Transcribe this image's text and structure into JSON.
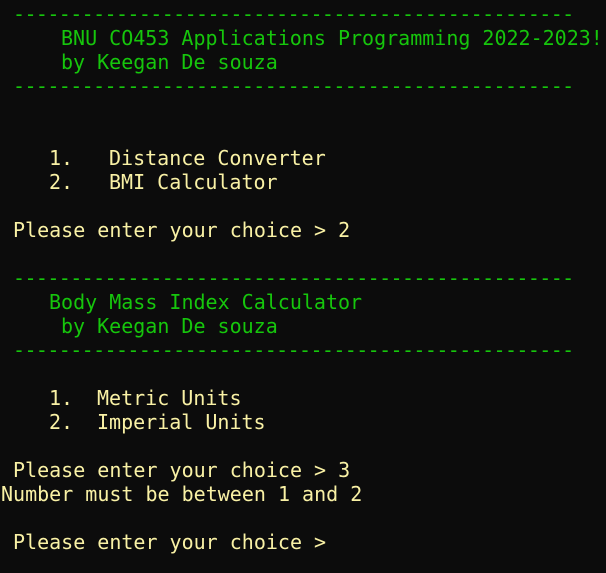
{
  "colors": {
    "background": "#0c0c0c",
    "header_text": "#16c60c",
    "body_text": "#f9f1a5"
  },
  "rule": "-------------------------------------------------",
  "main_header": {
    "title": "BNU CO453 Applications Programming 2022-2023!",
    "author": "by Keegan De souza"
  },
  "main_menu": {
    "options": [
      {
        "number": "1.",
        "label": "Distance Converter"
      },
      {
        "number": "2.",
        "label": "BMI Calculator"
      }
    ],
    "prompt": "Please enter your choice > 2"
  },
  "bmi_header": {
    "title": "Body Mass Index Calculator",
    "author": "by Keegan De souza"
  },
  "bmi_menu": {
    "options": [
      {
        "number": "1.",
        "label": "Metric Units"
      },
      {
        "number": "2.",
        "label": "Imperial Units"
      }
    ],
    "prompt_first": "Please enter your choice > 3",
    "error": "Number must be between 1 and 2",
    "prompt_current": "Please enter your choice >"
  }
}
